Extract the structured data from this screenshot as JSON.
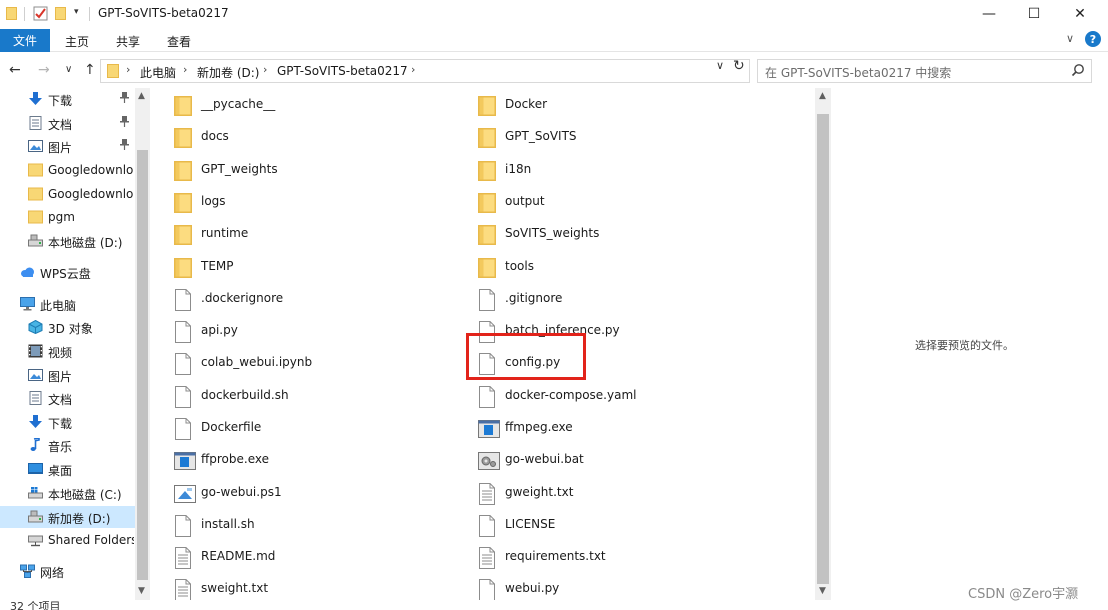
{
  "window": {
    "title": "GPT-SoVITS-beta0217",
    "minimize": "—",
    "maximize": "☐",
    "close": "✕"
  },
  "ribbon": {
    "tabs": [
      "文件",
      "主页",
      "共享",
      "查看"
    ],
    "expand": "∨",
    "help": "?"
  },
  "nav": {
    "back": "←",
    "forward": "→",
    "recent": "∨",
    "up": "↑",
    "breadcrumb": [
      "此电脑",
      "新加卷 (D:)",
      "GPT-SoVITS-beta0217"
    ],
    "crumb_sep": "›",
    "dropdown": "∨",
    "refresh": "↻"
  },
  "search": {
    "placeholder": "在 GPT-SoVITS-beta0217 中搜索"
  },
  "sidebar": {
    "items": [
      {
        "label": "下载",
        "icon": "download-arrow-icon",
        "pinned": true
      },
      {
        "label": "文档",
        "icon": "document-icon",
        "pinned": true
      },
      {
        "label": "图片",
        "icon": "pictures-icon",
        "pinned": true
      },
      {
        "label": "Googledownlo",
        "icon": "folder-icon",
        "pinned": false
      },
      {
        "label": "Googledownlo",
        "icon": "folder-icon",
        "pinned": false
      },
      {
        "label": "pgm",
        "icon": "folder-icon",
        "pinned": false
      },
      {
        "label": "本地磁盘 (D:)",
        "icon": "drive-icon",
        "pinned": false
      },
      {
        "label": "WPS云盘",
        "icon": "cloud-icon",
        "pinned": false,
        "root": true
      },
      {
        "label": "此电脑",
        "icon": "computer-icon",
        "pinned": false,
        "root": true
      },
      {
        "label": "3D 对象",
        "icon": "3d-objects-icon",
        "pinned": false
      },
      {
        "label": "视频",
        "icon": "video-icon",
        "pinned": false
      },
      {
        "label": "图片",
        "icon": "pictures-icon",
        "pinned": false
      },
      {
        "label": "文档",
        "icon": "document-icon",
        "pinned": false
      },
      {
        "label": "下载",
        "icon": "download-arrow-icon",
        "pinned": false
      },
      {
        "label": "音乐",
        "icon": "music-icon",
        "pinned": false
      },
      {
        "label": "桌面",
        "icon": "desktop-icon",
        "pinned": false
      },
      {
        "label": "本地磁盘 (C:)",
        "icon": "windows-drive-icon",
        "pinned": false
      },
      {
        "label": "新加卷 (D:)",
        "icon": "drive-icon",
        "pinned": false,
        "selected": true
      },
      {
        "label": "Shared Folders",
        "icon": "network-drive-icon",
        "pinned": false
      },
      {
        "label": "网络",
        "icon": "network-icon",
        "pinned": false,
        "root": true
      }
    ],
    "pin_glyph": "📌"
  },
  "files": {
    "left": [
      {
        "name": "__pycache__",
        "kind": "folder"
      },
      {
        "name": "docs",
        "kind": "folder"
      },
      {
        "name": "GPT_weights",
        "kind": "folder"
      },
      {
        "name": "logs",
        "kind": "folder"
      },
      {
        "name": "runtime",
        "kind": "folder"
      },
      {
        "name": "TEMP",
        "kind": "folder"
      },
      {
        "name": ".dockerignore",
        "kind": "file"
      },
      {
        "name": "api.py",
        "kind": "file"
      },
      {
        "name": "colab_webui.ipynb",
        "kind": "file"
      },
      {
        "name": "dockerbuild.sh",
        "kind": "file"
      },
      {
        "name": "Dockerfile",
        "kind": "file"
      },
      {
        "name": "ffprobe.exe",
        "kind": "exe"
      },
      {
        "name": "go-webui.ps1",
        "kind": "ps1"
      },
      {
        "name": "install.sh",
        "kind": "file"
      },
      {
        "name": "README.md",
        "kind": "text"
      },
      {
        "name": "sweight.txt",
        "kind": "text"
      }
    ],
    "right": [
      {
        "name": "Docker",
        "kind": "folder"
      },
      {
        "name": "GPT_SoVITS",
        "kind": "folder"
      },
      {
        "name": "i18n",
        "kind": "folder"
      },
      {
        "name": "output",
        "kind": "folder"
      },
      {
        "name": "SoVITS_weights",
        "kind": "folder"
      },
      {
        "name": "tools",
        "kind": "folder"
      },
      {
        "name": ".gitignore",
        "kind": "file"
      },
      {
        "name": "batch_inference.py",
        "kind": "file"
      },
      {
        "name": "config.py",
        "kind": "file",
        "highlighted": true
      },
      {
        "name": "docker-compose.yaml",
        "kind": "file"
      },
      {
        "name": "ffmpeg.exe",
        "kind": "exe"
      },
      {
        "name": "go-webui.bat",
        "kind": "bat"
      },
      {
        "name": "gweight.txt",
        "kind": "text"
      },
      {
        "name": "LICENSE",
        "kind": "file"
      },
      {
        "name": "requirements.txt",
        "kind": "text"
      },
      {
        "name": "webui.py",
        "kind": "file"
      }
    ]
  },
  "preview": {
    "empty_text": "选择要预览的文件。"
  },
  "status": {
    "count": "32 个项目"
  },
  "watermark": "CSDN @Zero宇灏",
  "colors": {
    "accent": "#1979ca",
    "folder": "#f8d775",
    "highlight": "#e2231a",
    "selected": "#cce8ff"
  }
}
